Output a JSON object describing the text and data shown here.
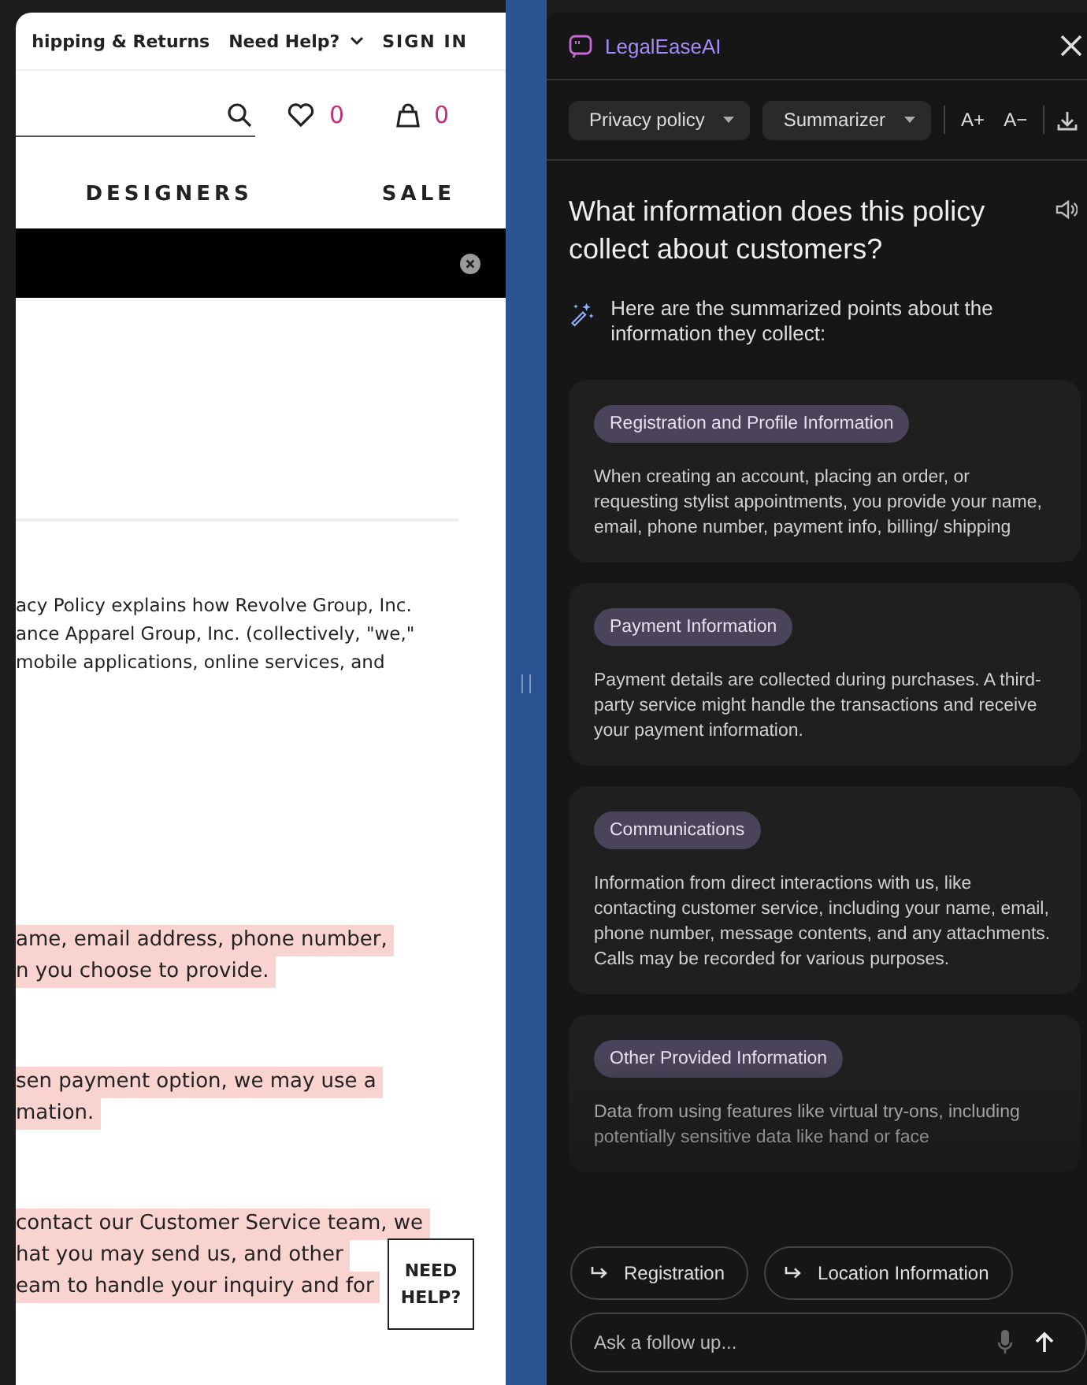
{
  "website": {
    "top_links": [
      {
        "label": "hipping & Returns",
        "kind": "link"
      },
      {
        "label": "Need Help?",
        "kind": "menu"
      },
      {
        "label": "SIGN IN",
        "kind": "link"
      }
    ],
    "wishlist_count": "0",
    "cart_count": "0",
    "nav": [
      "DESIGNERS",
      "SALE"
    ],
    "intro_lines": [
      "acy Policy explains how Revolve Group, Inc.",
      "ance Apparel Group, Inc. (collectively, \"we,\"",
      "mobile applications, online services, and"
    ],
    "highlighted_paragraphs": [
      [
        "ame, email address, phone number,",
        "n you choose to provide."
      ],
      [
        "sen payment option, we may use a",
        "mation."
      ],
      [
        "contact our Customer Service team, we",
        "hat you may send us, and other",
        "eam to handle your inquiry and for"
      ]
    ],
    "help_button": "NEED HELP?"
  },
  "assistant": {
    "app_name": "LegalEaseAI",
    "dropdowns": [
      {
        "label": "Privacy policy"
      },
      {
        "label": "Summarizer"
      }
    ],
    "font_buttons": [
      "A+",
      "A−"
    ],
    "question": "What information does this policy collect about customers?",
    "intro": "Here are the summarized points about the information they collect:",
    "cards": [
      {
        "tag": "Registration and Profile Information",
        "body": "When creating an account, placing an order, or requesting stylist appointments, you provide your name, email, phone number, payment info, billing/ shipping"
      },
      {
        "tag": "Payment Information",
        "body": "Payment details are collected during purchases. A third-party service might handle the transactions and receive your payment information."
      },
      {
        "tag": "Communications",
        "body": "Information from direct interactions with us, like contacting customer service, including your name, email, phone number, message contents, and any attachments. Calls may be recorded for various purposes."
      },
      {
        "tag": "Other Provided Information",
        "body": "Data from using features like virtual try-ons, including potentially sensitive data like hand or face"
      }
    ],
    "suggestions": [
      "Registration",
      "Location Information"
    ],
    "input": {
      "placeholder": "Ask a follow up..."
    }
  }
}
